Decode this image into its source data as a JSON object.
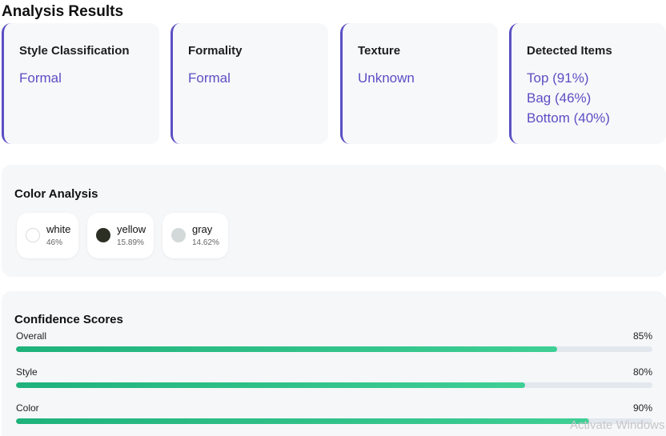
{
  "page": {
    "title": "Analysis Results"
  },
  "cards": [
    {
      "title": "Style Classification",
      "values": [
        "Formal"
      ]
    },
    {
      "title": "Formality",
      "values": [
        "Formal"
      ]
    },
    {
      "title": "Texture",
      "values": [
        "Unknown"
      ]
    },
    {
      "title": "Detected Items",
      "values": [
        "Top (91%)",
        "Bag (46%)",
        "Bottom (40%)"
      ]
    }
  ],
  "color_analysis": {
    "title": "Color Analysis",
    "colors": [
      {
        "name": "white",
        "percent": "46%",
        "swatch": "#ffffff",
        "border": "#d8dadd"
      },
      {
        "name": "yellow",
        "percent": "15.89%",
        "swatch": "#2b2f24",
        "border": "#2b2f24"
      },
      {
        "name": "gray",
        "percent": "14.62%",
        "swatch": "#d3d9d8",
        "border": "#d3d9d8"
      }
    ]
  },
  "confidence": {
    "title": "Confidence Scores",
    "scores": [
      {
        "label": "Overall",
        "value": 85,
        "text": "85%"
      },
      {
        "label": "Style",
        "value": 80,
        "text": "80%"
      },
      {
        "label": "Color",
        "value": 90,
        "text": "90%"
      }
    ]
  },
  "theme": {
    "accent": "#5b4fc4",
    "bar": "#22b47d"
  },
  "watermark": "Activate Windows"
}
